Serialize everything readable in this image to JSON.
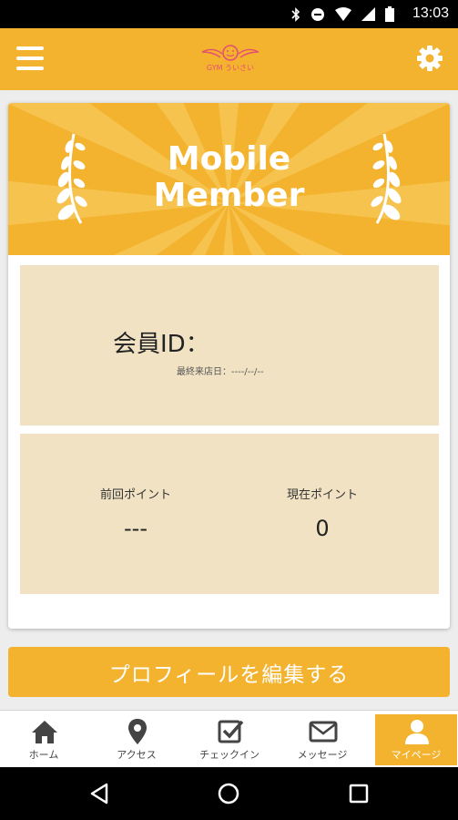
{
  "status_bar": {
    "time": "13:03"
  },
  "app_bar": {
    "logo_text": "GYM ういさい"
  },
  "banner": {
    "title_line1": "Mobile",
    "title_line2": "Member"
  },
  "member": {
    "id_label": "会員ID：",
    "last_visit": "最終来店日：----/--/--"
  },
  "points": {
    "previous_label": "前回ポイント",
    "previous_value": "---",
    "current_label": "現在ポイント",
    "current_value": "0"
  },
  "edit_profile_label": "プロフィールを編集する",
  "bottom_nav": {
    "items": [
      {
        "label": "ホーム",
        "icon": "home-icon"
      },
      {
        "label": "アクセス",
        "icon": "map-pin-icon"
      },
      {
        "label": "チェックイン",
        "icon": "checkbox-icon"
      },
      {
        "label": "メッセージ",
        "icon": "envelope-icon"
      },
      {
        "label": "マイページ",
        "icon": "person-icon",
        "active": true
      }
    ]
  },
  "colors": {
    "accent": "#f3b32f",
    "panel": "#f1e2c3"
  }
}
